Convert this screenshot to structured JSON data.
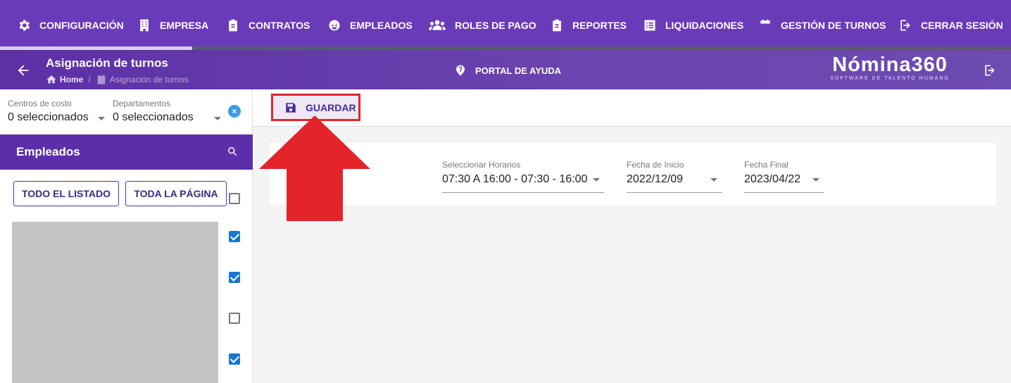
{
  "topnav": {
    "items": [
      {
        "label": "CONFIGURACIÓN",
        "icon": "gear-icon"
      },
      {
        "label": "EMPRESA",
        "icon": "building-icon"
      },
      {
        "label": "CONTRATOS",
        "icon": "clipboard-icon"
      },
      {
        "label": "EMPLEADOS",
        "icon": "face-icon"
      },
      {
        "label": "ROLES DE PAGO",
        "icon": "people-icon"
      },
      {
        "label": "REPORTES",
        "icon": "report-icon"
      },
      {
        "label": "LIQUIDACIONES",
        "icon": "list-icon"
      },
      {
        "label": "GESTIÓN DE TURNOS",
        "icon": "calendar-icon"
      },
      {
        "label": "CERRAR SESIÓN",
        "icon": "logout-icon"
      }
    ]
  },
  "header": {
    "title": "Asignación de turnos",
    "breadcrumb": {
      "home": "Home",
      "current": "Asignación de turnos"
    },
    "help": "PORTAL DE AYUDA",
    "brand": {
      "name": "Nómina360",
      "tagline": "SOFTWARE DE TALENTO HUMANO"
    }
  },
  "filters": {
    "cost_centers": {
      "label": "Centros de costo",
      "value": "0 seleccionados"
    },
    "departments": {
      "label": "Departamentos",
      "value": "0 seleccionados"
    },
    "clear": "×"
  },
  "employees": {
    "title": "Empleados",
    "all_list": "TODO EL LISTADO",
    "whole_page": "TODA LA PÁGINA",
    "checkboxes": [
      false,
      true,
      true,
      false,
      true
    ]
  },
  "toolbar": {
    "save": "GUARDAR"
  },
  "schedule": {
    "horarios": {
      "label": "Seleccionar Horarios",
      "value": "07:30 A 16:00 - 07:30 - 16:00"
    },
    "start": {
      "label": "Fecha de Inicio",
      "value": "2022/12/09"
    },
    "end": {
      "label": "Fecha Final",
      "value": "2023/04/22"
    }
  },
  "colors": {
    "nav": "#6a3bb8",
    "accent": "#5c2fa8",
    "highlight": "#e3242b",
    "checkbox": "#1976d2"
  }
}
